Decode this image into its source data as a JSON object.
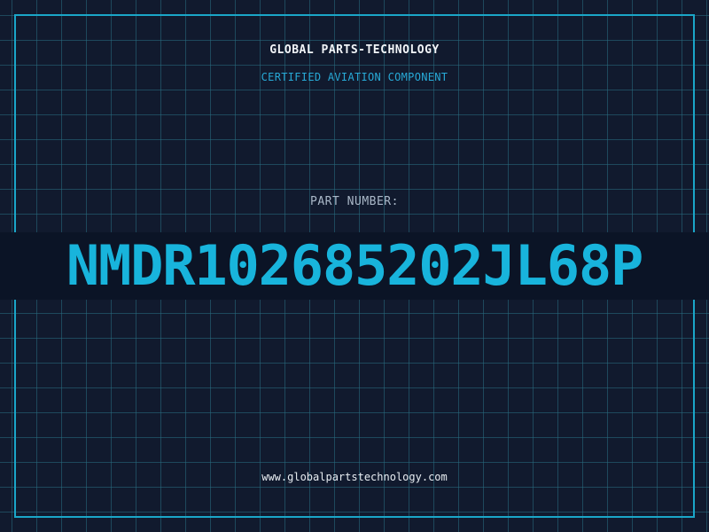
{
  "header": {
    "brand": "GLOBAL PARTS-TECHNOLOGY",
    "tagline": "CERTIFIED AVIATION COMPONENT"
  },
  "part": {
    "label": "PART NUMBER:",
    "number": "NMDR102685202JL68P"
  },
  "footer": {
    "url": "www.globalpartstechnology.com"
  },
  "colors": {
    "background": "#111a2e",
    "grid": "#286e82",
    "accent": "#18b4dc",
    "frame": "#1aa6c8",
    "brand_text": "#f2f5f8",
    "label_text": "#aab8c8"
  }
}
